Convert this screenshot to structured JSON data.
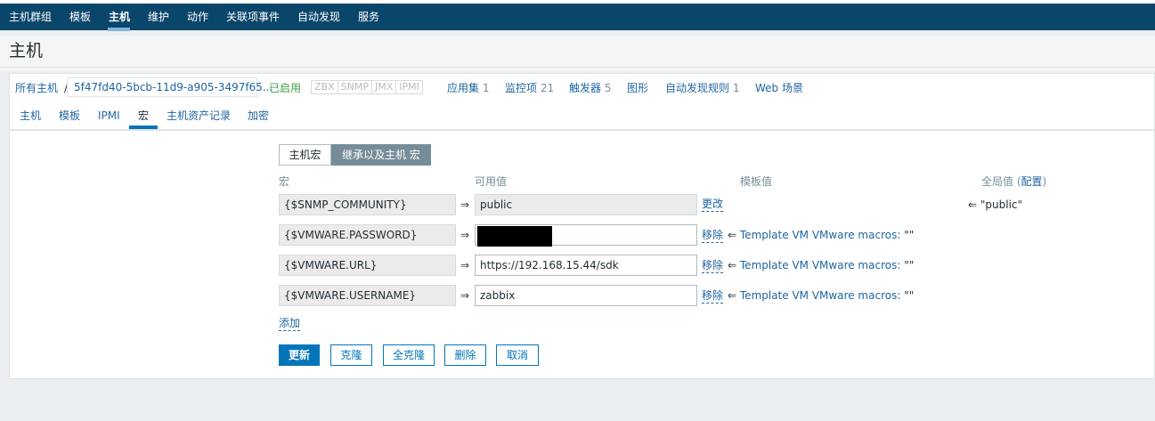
{
  "topnav": {
    "items": [
      "主机群组",
      "模板",
      "主机",
      "维护",
      "动作",
      "关联项事件",
      "自动发现",
      "服务"
    ]
  },
  "page": {
    "title": "主机"
  },
  "breadcrumb": {
    "all_hosts": "所有主机",
    "separator": "/",
    "host_name": "5f47fd40-5bcb-11d9-a905-3497f65...",
    "status": "已启用",
    "badges": [
      "ZBX",
      "SNMP",
      "JMX",
      "IPMI"
    ],
    "links": [
      {
        "label": "应用集",
        "count": "1"
      },
      {
        "label": "监控项",
        "count": "21"
      },
      {
        "label": "触发器",
        "count": "5"
      },
      {
        "label": "图形",
        "count": ""
      },
      {
        "label": "自动发现规则",
        "count": "1"
      },
      {
        "label": "Web 场景",
        "count": ""
      }
    ]
  },
  "tabs": [
    "主机",
    "模板",
    "IPMI",
    "宏",
    "主机资产记录",
    "加密"
  ],
  "segmented": {
    "host_macros": "主机宏",
    "inherited_macros": "继承以及主机 宏"
  },
  "columns": {
    "macro": "宏",
    "effective_value": "可用值",
    "template_value": "模板值",
    "global_value": "全局值",
    "global_config_open": " (",
    "global_config_link": "配置",
    "global_config_close": ")"
  },
  "macros": [
    {
      "name": "{$SNMP_COMMUNITY}",
      "arrow": "⇒",
      "value": "public",
      "action": "更改",
      "template_arrow": "",
      "template_name": "",
      "template_value": "",
      "global_arrow": "⇐",
      "global_value": "\"public\""
    },
    {
      "name": "{$VMWARE.PASSWORD}",
      "arrow": "⇒",
      "value": "",
      "action": "移除",
      "template_arrow": "⇐",
      "template_name": "Template VM VMware macros:",
      "template_value": " \"\""
    },
    {
      "name": "{$VMWARE.URL}",
      "arrow": "⇒",
      "value": "https://192.168.15.44/sdk",
      "action": "移除",
      "template_arrow": "⇐",
      "template_name": "Template VM VMware macros:",
      "template_value": " \"\""
    },
    {
      "name": "{$VMWARE.USERNAME}",
      "arrow": "⇒",
      "value": "zabbix",
      "action": "移除",
      "template_arrow": "⇐",
      "template_name": "Template VM VMware macros:",
      "template_value": " \"\""
    }
  ],
  "add_label": "添加",
  "buttons": {
    "update": "更新",
    "clone": "克隆",
    "full_clone": "全克隆",
    "delete": "删除",
    "cancel": "取消"
  }
}
